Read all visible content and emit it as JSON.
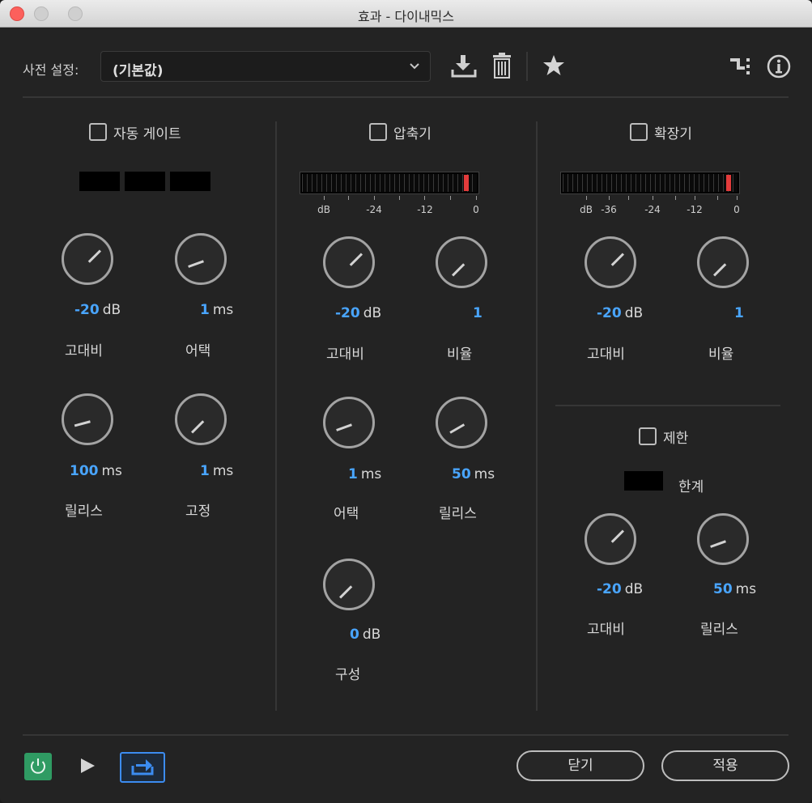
{
  "window": {
    "title": "효과 - 다이내믹스"
  },
  "preset": {
    "label": "사전 설정:",
    "value": "(기본값)"
  },
  "toolbar_icons": [
    "save-preset-icon",
    "delete-preset-icon",
    "favorite-star-icon",
    "routing-icon",
    "info-icon"
  ],
  "sections": {
    "autogate": {
      "label": "자동 게이트",
      "knobs": [
        {
          "value": "-20",
          "unit": "dB",
          "label": "고대비",
          "pointer_deg": 45
        },
        {
          "value": "1",
          "unit": "ms",
          "label": "어택",
          "pointer_deg": -110
        },
        {
          "value": "100",
          "unit": "ms",
          "label": "릴리스",
          "pointer_deg": -105
        },
        {
          "value": "1",
          "unit": "ms",
          "label": "고정",
          "pointer_deg": -135
        }
      ]
    },
    "compressor": {
      "label": "압축기",
      "meter_scale": [
        "dB",
        "-24",
        "-12",
        "0"
      ],
      "knobs": [
        {
          "value": "-20",
          "unit": "dB",
          "label": "고대비",
          "pointer_deg": 45
        },
        {
          "value": "1",
          "unit": "",
          "label": "비율",
          "pointer_deg": -135
        },
        {
          "value": "1",
          "unit": "ms",
          "label": "어택",
          "pointer_deg": -110
        },
        {
          "value": "50",
          "unit": "ms",
          "label": "릴리스",
          "pointer_deg": -120
        },
        {
          "value": "0",
          "unit": "dB",
          "label": "구성",
          "pointer_deg": -135
        }
      ]
    },
    "expander": {
      "label": "확장기",
      "meter_scale": [
        "dB",
        "-36",
        "-24",
        "-12",
        "0"
      ],
      "knobs": [
        {
          "value": "-20",
          "unit": "dB",
          "label": "고대비",
          "pointer_deg": 45
        },
        {
          "value": "1",
          "unit": "",
          "label": "비율",
          "pointer_deg": -135
        }
      ]
    },
    "limiter": {
      "label": "제한",
      "threshold_label": "한계",
      "knobs": [
        {
          "value": "-20",
          "unit": "dB",
          "label": "고대비",
          "pointer_deg": 45
        },
        {
          "value": "50",
          "unit": "ms",
          "label": "릴리스",
          "pointer_deg": -110
        }
      ]
    }
  },
  "footer": {
    "close_label": "닫기",
    "apply_label": "적용"
  },
  "colors": {
    "accent_blue": "#49a5ff",
    "power_green": "#2f9b63",
    "meter_peak": "#e23b3b"
  }
}
